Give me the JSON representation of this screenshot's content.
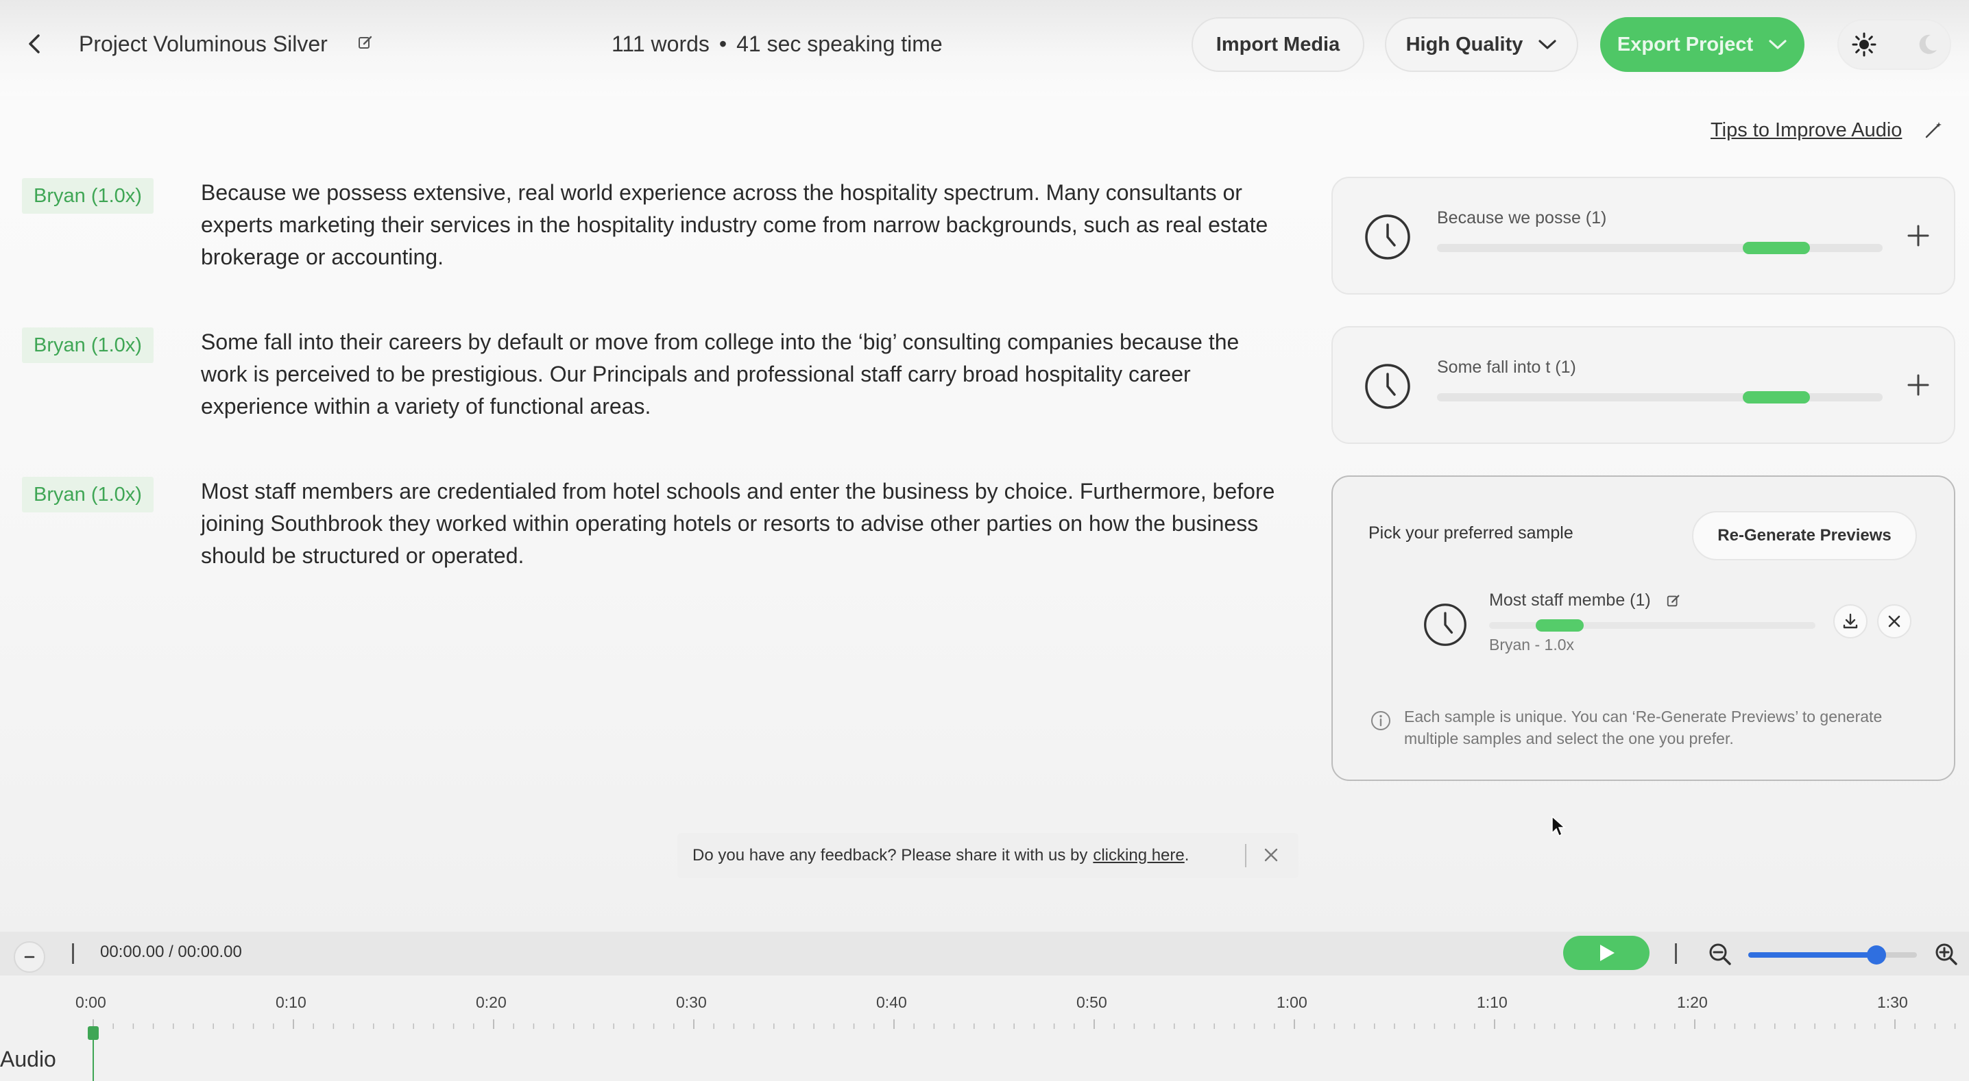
{
  "header": {
    "project_title": "Project Voluminous Silver",
    "word_count": "111 words",
    "speaking_time": "41 sec speaking time",
    "import_label": "Import Media",
    "quality_label": "High Quality",
    "export_label": "Export Project"
  },
  "tips_label": "Tips to Improve Audio",
  "script": [
    {
      "speaker": "Bryan (1.0x)",
      "text": "Because we possess extensive, real world experience across the hospitality spectrum. Many consultants or experts marketing their services in the hospitality industry come from narrow backgrounds, such as real estate brokerage or accounting."
    },
    {
      "speaker": "Bryan (1.0x)",
      "text": "Some fall into their careers by default or move from college into the ‘big’ consulting companies because the work is perceived to be prestigious. Our Principals and professional staff carry broad hospitality career experience within a variety of functional areas."
    },
    {
      "speaker": "Bryan (1.0x)",
      "text": "Most staff members are credentialed from hotel schools and enter the business by choice. Furthermore, before joining Southbrook they worked within operating hotels or resorts to advise other parties on how the business should be structured or operated."
    }
  ],
  "previews": [
    {
      "title": "Because we posse (1)"
    },
    {
      "title": "Some fall into t (1)"
    }
  ],
  "picker": {
    "label": "Pick your preferred sample",
    "regenerate_label": "Re-Generate Previews",
    "sample_title": "Most staff membe (1)",
    "sample_voice": "Bryan - 1.0x",
    "info_text": "Each sample is unique. You can ‘Re-Generate Previews’ to generate multiple samples and select the one you prefer."
  },
  "feedback": {
    "text": "Do you have any feedback? Please share it with us by",
    "link": "clicking here",
    "suffix": "."
  },
  "player": {
    "timecode": "00:00.00 / 00:00.00",
    "zoom_level": 0.76
  },
  "timeline": {
    "ticks": [
      "0:00",
      "0:10",
      "0:20",
      "0:30",
      "0:40",
      "0:50",
      "1:00",
      "1:10",
      "1:20",
      "1:30"
    ],
    "track_label": "Audio"
  },
  "colors": {
    "accent_green": "#4fc766",
    "tag_bg": "#e8f3e8",
    "tag_text": "#3fa655",
    "slider_blue": "#2f6fe0"
  }
}
